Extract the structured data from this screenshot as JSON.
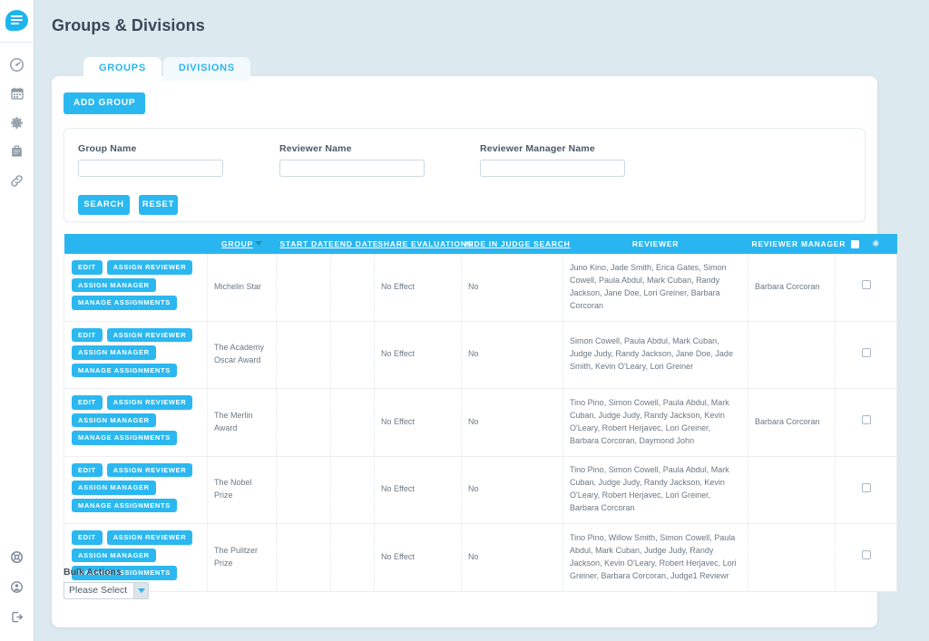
{
  "page": {
    "title": "Groups & Divisions",
    "background_color": "#dce9ef",
    "accent_color": "#29b6f0"
  },
  "sidebar": {
    "logo_icon": "chat-bubble-menu-icon",
    "items": [
      {
        "icon": "dashboard-gauge-icon",
        "name": "dashboard"
      },
      {
        "icon": "calendar-icon",
        "name": "calendar"
      },
      {
        "icon": "gear-settings-icon",
        "name": "settings"
      },
      {
        "icon": "clipboard-icon",
        "name": "clipboard"
      },
      {
        "icon": "link-chain-icon",
        "name": "links"
      }
    ],
    "bottom_items": [
      {
        "icon": "lifebuoy-help-icon",
        "name": "help"
      },
      {
        "icon": "user-account-icon",
        "name": "account"
      },
      {
        "icon": "logout-arrow-icon",
        "name": "logout"
      }
    ]
  },
  "tabs": [
    {
      "label": "GROUPS",
      "active": true
    },
    {
      "label": "DIVISIONS",
      "active": false
    }
  ],
  "toolbar": {
    "add_group_label": "ADD GROUP"
  },
  "search_panel": {
    "fields": [
      {
        "label": "Group Name",
        "value": "",
        "placeholder": ""
      },
      {
        "label": "Reviewer Name",
        "value": "",
        "placeholder": ""
      },
      {
        "label": "Reviewer Manager Name",
        "value": "",
        "placeholder": ""
      }
    ],
    "search_label": "SEARCH",
    "reset_label": "RESET"
  },
  "table": {
    "headers": {
      "actions": "",
      "group": "GROUP",
      "start_date": "START DATE",
      "end_date": "END DATE",
      "share_evaluations": "SHARE EVALUATIONS",
      "hide_in_judge_search": "HIDE IN JUDGE SEARCH",
      "reviewer": "REVIEWER",
      "reviewer_manager": "REVIEWER MANAGER",
      "select_all_icon": "checkbox-icon",
      "settings_icon": "gear-icon"
    },
    "sort_column": "GROUP",
    "sort_direction": "desc",
    "row_buttons": {
      "edit": "EDIT",
      "assign_reviewer": "ASSIGN REVIEWER",
      "assign_manager": "ASSIGN MANAGER",
      "manage_assignments": "MANAGE ASSIGNMENTS"
    },
    "rows": [
      {
        "group": "Michelin Star",
        "start_date": "",
        "end_date": "",
        "share_evaluations": "No Effect",
        "hide_in_judge_search": "No",
        "reviewer": "Juno Kino, Jade Smith, Erica Gates, Simon Cowell, Paula Abdul, Mark Cuban, Randy Jackson, Jane Doe, Lori Greiner, Barbara Corcoran",
        "reviewer_manager": "Barbara Corcoran",
        "selected": false
      },
      {
        "group": "The Academy Oscar Award",
        "start_date": "",
        "end_date": "",
        "share_evaluations": "No Effect",
        "hide_in_judge_search": "No",
        "reviewer": "Simon Cowell, Paula Abdul, Mark Cuban, Judge Judy, Randy Jackson, Jane Doe, Jade Smith, Kevin O'Leary, Lori Greiner",
        "reviewer_manager": "",
        "selected": false
      },
      {
        "group": "The Merlin Award",
        "start_date": "",
        "end_date": "",
        "share_evaluations": "No Effect",
        "hide_in_judge_search": "No",
        "reviewer": "Tino Pino, Simon Cowell, Paula Abdul, Mark Cuban, Judge Judy, Randy Jackson, Kevin O'Leary, Robert Herjavec, Lori Greiner, Barbara Corcoran, Daymond John",
        "reviewer_manager": "Barbara Corcoran",
        "selected": false
      },
      {
        "group": "The Nobel Prize",
        "start_date": "",
        "end_date": "",
        "share_evaluations": "No Effect",
        "hide_in_judge_search": "No",
        "reviewer": "Tino Pino, Simon Cowell, Paula Abdul, Mark Cuban, Judge Judy, Randy Jackson, Kevin O'Leary, Robert Herjavec, Lori Greiner, Barbara Corcoran",
        "reviewer_manager": "",
        "selected": false
      },
      {
        "group": "The Pulitzer Prize",
        "start_date": "",
        "end_date": "",
        "share_evaluations": "No Effect",
        "hide_in_judge_search": "No",
        "reviewer": "Tino Pino, Willow Smith, Simon Cowell, Paula Abdul, Mark Cuban, Judge Judy, Randy Jackson, Kevin O'Leary, Robert Herjavec, Lori Greiner, Barbara Corcoran, Judge1 Reviewr",
        "reviewer_manager": "",
        "selected": false
      }
    ]
  },
  "bulk_actions": {
    "label": "Bulk Actions",
    "selected": "Please Select"
  }
}
